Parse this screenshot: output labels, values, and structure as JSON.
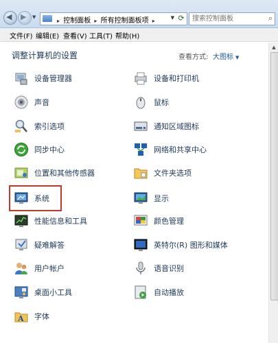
{
  "address": {
    "crumbs": [
      "控制面板",
      "所有控制面板项"
    ],
    "search_placeholder": "搜索控制面板"
  },
  "menu": [
    "文件(F)",
    "编辑(E)",
    "查看(V)",
    "工具(T)",
    "帮助(H)"
  ],
  "heading": "调整计算机的设置",
  "view_by": {
    "label": "查看方式:",
    "value": "大图标"
  },
  "items": {
    "device_manager": "设备管理器",
    "devices_printers": "设备和打印机",
    "sound": "声音",
    "mouse": "鼠标",
    "indexing": "索引选项",
    "notification_icons": "通知区域图标",
    "sync_center": "同步中心",
    "network": "网络和共享中心",
    "location": "位置和其他传感器",
    "folder_options": "文件夹选项",
    "system": "系统",
    "display": "显示",
    "performance": "性能信息和工具",
    "color": "颜色管理",
    "troubleshoot": "疑难解答",
    "intel_graphics": "英特尔(R) 图形和媒体",
    "user_accounts": "用户帐户",
    "speech": "语音识别",
    "gadgets": "桌面小工具",
    "autoplay": "自动播放",
    "fonts": "字体"
  },
  "colors": {
    "accent": "#1e395b",
    "highlight_box": "#c0392b"
  }
}
